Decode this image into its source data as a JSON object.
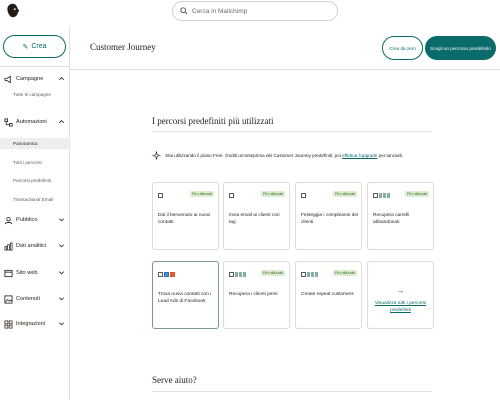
{
  "search": {
    "placeholder": "Cerca in Mailchimp"
  },
  "sidebar": {
    "create_label": "Crea",
    "items": [
      {
        "label": "Campagne",
        "icon": "megaphone-icon",
        "expanded": true,
        "sub": [
          "Tutte le campagne"
        ]
      },
      {
        "label": "Automazioni",
        "icon": "automation-icon",
        "expanded": true,
        "sub": [
          "Panoramica",
          "Tutti i percorsi",
          "Percorsi predefiniti",
          "Transactional Email"
        ],
        "active_sub": "Panoramica"
      },
      {
        "label": "Pubblico",
        "icon": "audience-icon",
        "expanded": false
      },
      {
        "label": "Dati analitici",
        "icon": "analytics-icon",
        "expanded": false
      },
      {
        "label": "Sito web",
        "icon": "website-icon",
        "expanded": false
      },
      {
        "label": "Contenuti",
        "icon": "content-icon",
        "expanded": false
      },
      {
        "label": "Integrazioni",
        "icon": "integrations-icon",
        "expanded": false
      }
    ]
  },
  "header": {
    "title": "Customer Journey",
    "scratch_label": "Crea da zero",
    "choose_label": "Scegli un percorso predefinito"
  },
  "main": {
    "section_title": "I percorsi predefiniti più utilizzati",
    "free_note_text": "Stai utilizzando il piano Free. Goditi un'anteprima dei Customer Journey predefiniti, poi ",
    "free_note_link": "effettua l'upgrade",
    "free_note_suffix": " per lanciarli.",
    "badge_label": "Più utilizzati",
    "cards": [
      {
        "title": "Dai il benvenuto ai nuovi contatti",
        "icons": [
          "email"
        ]
      },
      {
        "title": "Invia email ai clienti con tag",
        "icons": [
          "email"
        ]
      },
      {
        "title": "Festeggia i compleanni dei clienti",
        "icons": [
          "email"
        ]
      },
      {
        "title": "Recupera carrelli abbandonati",
        "icons": [
          "email",
          "store",
          "store"
        ]
      },
      {
        "title": "Trova nuovi contatti con i Lead Ads di Facebook",
        "icons": [
          "email",
          "facebook",
          "red"
        ],
        "selected": true
      },
      {
        "title": "Recupera i clienti persi",
        "icons": [
          "email",
          "store",
          "store"
        ]
      },
      {
        "title": "Create repeat customers",
        "icons": [
          "email",
          "store",
          "store"
        ]
      }
    ],
    "view_all_label": "Visualizza tutti i percorsi predefiniti",
    "help_title": "Serve aiuto?"
  }
}
